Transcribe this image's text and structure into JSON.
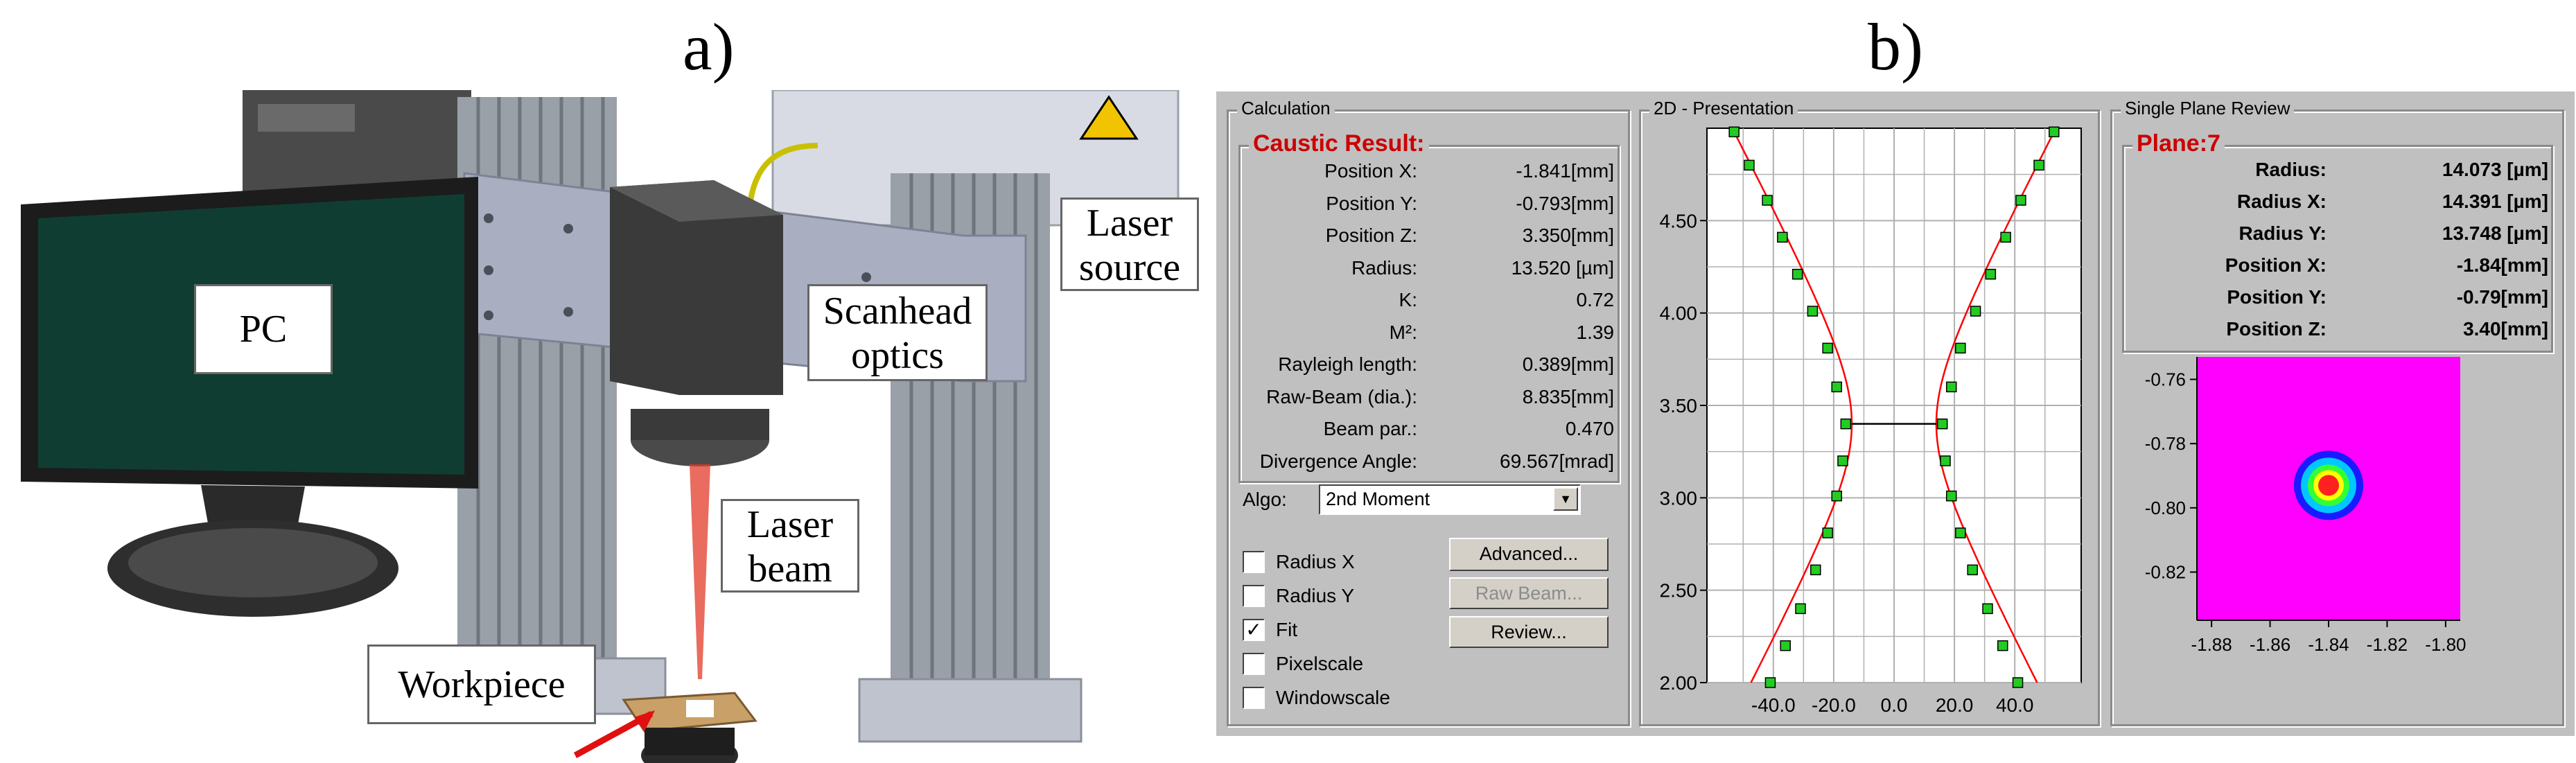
{
  "figure_labels": {
    "a": "a)",
    "b": "b)"
  },
  "setup": {
    "callouts": {
      "pc": "PC",
      "laser_source_1": "Laser",
      "laser_source_2": "source",
      "scanhead_1": "Scanhead",
      "scanhead_2": "optics",
      "laser_beam_1": "Laser",
      "laser_beam_2": "beam",
      "workpiece": "Workpiece"
    },
    "colors": {
      "frame": "#9aa0a8",
      "frame_dark": "#6f757d",
      "plate": "#a9afc0",
      "monitor": "#1c1c1c",
      "screen": "#0f3d32",
      "beam": "#e23b2a",
      "arrow": "#e01010",
      "box": "#3a3a3a"
    }
  },
  "calculation": {
    "title": "Calculation",
    "result_title": "Caustic Result:",
    "rows": [
      {
        "label": "Position X:",
        "value": "-1.841[mm]"
      },
      {
        "label": "Position Y:",
        "value": "-0.793[mm]"
      },
      {
        "label": "Position Z:",
        "value": "3.350[mm]"
      },
      {
        "label": "Radius:",
        "value": "13.520 [µm]"
      },
      {
        "label": "K:",
        "value": "0.72"
      },
      {
        "label": "M²:",
        "value": "1.39"
      },
      {
        "label": "Rayleigh length:",
        "value": "0.389[mm]"
      },
      {
        "label": "Raw-Beam (dia.):",
        "value": "8.835[mm]"
      },
      {
        "label": "Beam par.:",
        "value": "0.470"
      },
      {
        "label": "Divergence Angle:",
        "value": "69.567[mrad]"
      }
    ],
    "algo_label": "Algo:",
    "algo_value": "2nd Moment",
    "checkboxes": [
      {
        "label": "Radius X",
        "checked": false
      },
      {
        "label": "Radius Y",
        "checked": false
      },
      {
        "label": "Fit",
        "checked": true
      },
      {
        "label": "Pixelscale",
        "checked": false
      },
      {
        "label": "Windowscale",
        "checked": false
      }
    ],
    "buttons": {
      "advanced": "Advanced...",
      "raw_beam": "Raw Beam...",
      "review": "Review..."
    }
  },
  "presentation": {
    "title": "2D - Presentation",
    "chart_data": {
      "type": "scatter",
      "title": "",
      "x_ticks": [
        "-40.0",
        "-20.0",
        "0.0",
        "20.0",
        "40.0"
      ],
      "y_ticks": [
        "2.00",
        "2.50",
        "3.00",
        "3.50",
        "4.00",
        "4.50"
      ],
      "xlim": [
        -62,
        62
      ],
      "ylim": [
        2.0,
        5.0
      ],
      "grid": true,
      "waist_z": 3.4,
      "waist_radius": 14.0,
      "series": [
        {
          "x": [
            -53.0,
            -48.0,
            -42.0,
            -37.0,
            -33.0,
            -29.0,
            -25.0,
            -21.0,
            -18.0,
            -15.0,
            -15.0,
            -16.0,
            -19.0,
            -22.0,
            -27.0,
            -31.0,
            -35.0,
            -41.0,
            -46.0,
            -50.0,
            -55.0
          ],
          "y": [
            4.98,
            4.8,
            4.61,
            4.41,
            4.21,
            4.01,
            3.81,
            3.6,
            3.4,
            3.2,
            3.0,
            2.81,
            2.61,
            2.4,
            2.2,
            2.0,
            2.61,
            2.4,
            2.2,
            2.0,
            2.0
          ]
        }
      ],
      "left_points": [
        [
          -53,
          4.98
        ],
        [
          -48,
          4.8
        ],
        [
          -42,
          4.61
        ],
        [
          -37,
          4.41
        ],
        [
          -32,
          4.21
        ],
        [
          -27,
          4.01
        ],
        [
          -22,
          3.81
        ],
        [
          -19,
          3.6
        ],
        [
          -16,
          3.4
        ],
        [
          -17,
          3.2
        ],
        [
          -19,
          3.01
        ],
        [
          -22,
          2.81
        ],
        [
          -26,
          2.61
        ],
        [
          -31,
          2.4
        ],
        [
          -36,
          2.2
        ],
        [
          -41,
          2.0
        ]
      ],
      "right_points": [
        [
          53,
          4.98
        ],
        [
          48,
          4.8
        ],
        [
          42,
          4.61
        ],
        [
          37,
          4.41
        ],
        [
          32,
          4.21
        ],
        [
          27,
          4.01
        ],
        [
          22,
          3.81
        ],
        [
          19,
          3.6
        ],
        [
          16,
          3.4
        ],
        [
          17,
          3.2
        ],
        [
          19,
          3.01
        ],
        [
          22,
          2.81
        ],
        [
          26,
          2.61
        ],
        [
          31,
          2.4
        ],
        [
          36,
          2.2
        ],
        [
          41,
          2.0
        ]
      ],
      "colors": {
        "fit": "#ff0000",
        "points": "#22cc22",
        "grid": "#b0b0b0"
      }
    }
  },
  "review": {
    "title": "Single Plane Review",
    "plane_title": "Plane:7",
    "rows": [
      {
        "label": "Radius:",
        "value": "14.073 [µm]"
      },
      {
        "label": "Radius X:",
        "value": "14.391 [µm]"
      },
      {
        "label": "Radius Y:",
        "value": "13.748 [µm]"
      },
      {
        "label": "Position X:",
        "value": "-1.84[mm]"
      },
      {
        "label": "Position Y:",
        "value": "-0.79[mm]"
      },
      {
        "label": "Position Z:",
        "value": "3.40[mm]"
      }
    ],
    "chart_data": {
      "type": "heatmap",
      "x_ticks": [
        "-1.88",
        "-1.86",
        "-1.84",
        "-1.82",
        "-1.80"
      ],
      "y_ticks": [
        "-0.76",
        "-0.78",
        "-0.80",
        "-0.82"
      ],
      "xlim": [
        -1.885,
        -1.795
      ],
      "ylim": [
        -0.835,
        -0.753
      ],
      "spot_center": [
        -1.84,
        -0.793
      ],
      "colors": {
        "background": "#ff00ff",
        "ring_outer": "#1a1aff",
        "ring_mid": "#00c8ff",
        "ring_inner": "#33ff33",
        "ring_core": "#ffff00",
        "core": "#ff2020"
      }
    }
  }
}
